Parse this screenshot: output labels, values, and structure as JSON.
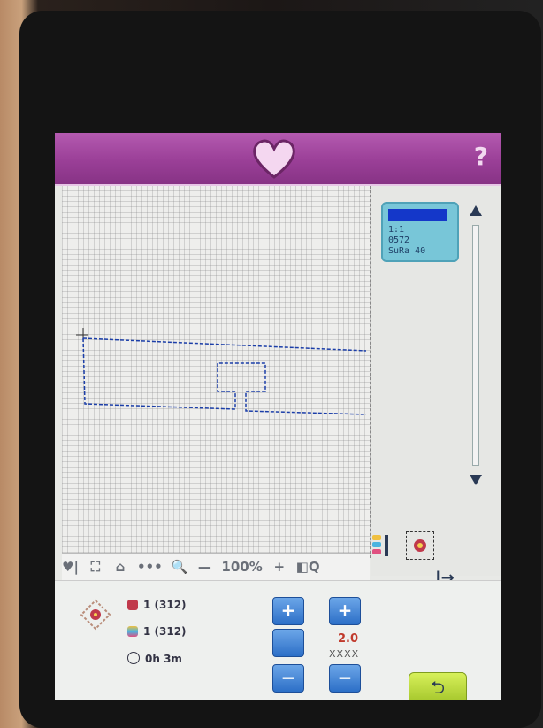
{
  "header": {
    "help_label": "?"
  },
  "thread_card": {
    "line1": "1:1",
    "line2": "0572",
    "line3": "SuRa 40",
    "swatch_color": "#1437c9"
  },
  "toolbar": {
    "favorite_label": "♥|",
    "fit_label": "⛶",
    "hoop_label": "⌂",
    "more_label": "•••",
    "search_label": "🔍",
    "minus_label": "—",
    "zoom_value": "100%",
    "plus_label": "+",
    "zoom_box_label": "◧Q"
  },
  "bottom": {
    "stitches_color_label": "1 (312)",
    "stitches_thread_label": "1 (312)",
    "time_label": "0h 3m",
    "value_label": "2.0",
    "zig_label": "XXXX"
  },
  "buttons": {
    "plus1": "+",
    "minus1": "−",
    "plus2": "+",
    "minus2": "−",
    "middle": "",
    "back": "⮌"
  },
  "colors": {
    "accent": "#9a3f97",
    "button_blue": "#2c6fc7",
    "stitch_blue": "#1b3ea8"
  }
}
